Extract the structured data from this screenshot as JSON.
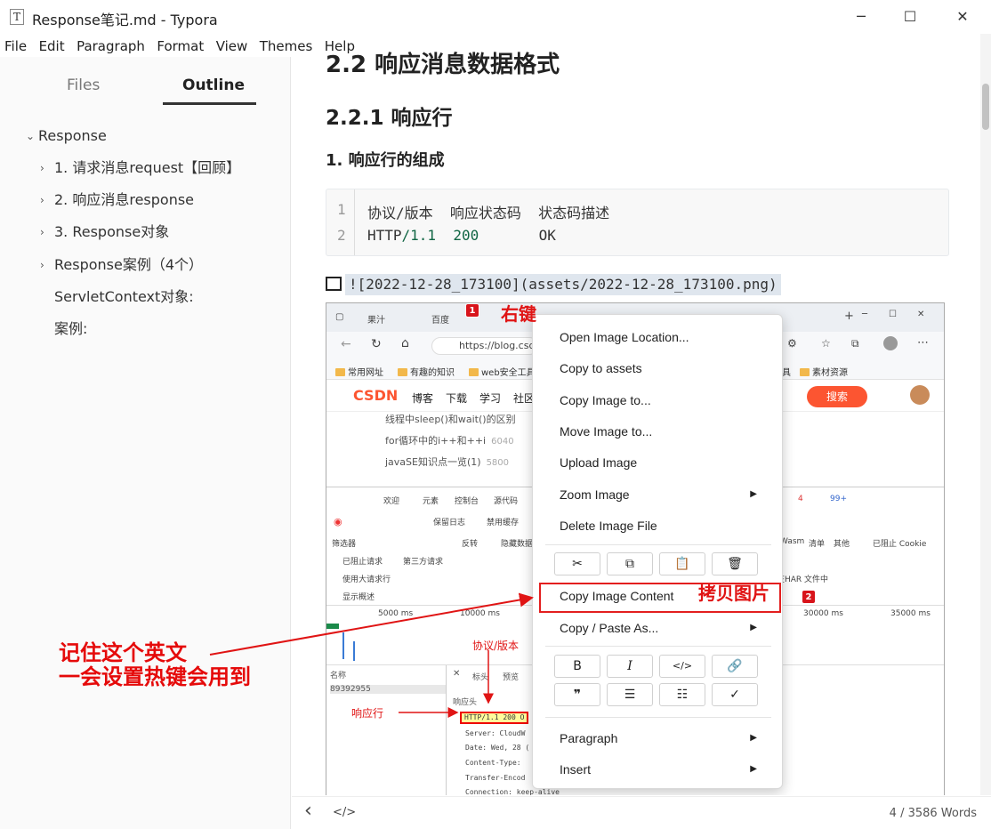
{
  "window": {
    "title": "Response笔记.md - Typora",
    "app_glyph": "T",
    "minimize": "─",
    "maximize": "☐",
    "close": "✕"
  },
  "menu": [
    "File",
    "Edit",
    "Paragraph",
    "Format",
    "View",
    "Themes",
    "Help"
  ],
  "sidebar": {
    "tabs": {
      "files": "Files",
      "outline": "Outline",
      "active": "Outline"
    },
    "outline": [
      {
        "label": "Response",
        "level": 0,
        "expanded": true
      },
      {
        "label": "1. 请求消息request【回顾】",
        "level": 1
      },
      {
        "label": "2. 响应消息response",
        "level": 1
      },
      {
        "label": "3. Response对象",
        "level": 1
      },
      {
        "label": "Response案例（4个）",
        "level": 1
      },
      {
        "label": "ServletContext对象:",
        "level": 1
      },
      {
        "label": "案例:",
        "level": 1
      }
    ]
  },
  "doc": {
    "h2": "2.2 响应消息数据格式",
    "h3": "2.2.1 响应行",
    "h4": "1. 响应行的组成",
    "code": {
      "line_numbers": [
        "1",
        "2"
      ],
      "line1": "协议/版本  响应状态码  状态码描述",
      "line2_a": "HTTP",
      "line2_b": "/1.1  200",
      "line2_c": "       OK"
    },
    "image_markdown": "![2022-12-28_173100](assets/2022-12-28_173100.png)"
  },
  "screenshot": {
    "tabs": [
      "果汁",
      "百度",
      "https://blog.csdn"
    ],
    "address": "https://blog.csdn",
    "bookmarks": [
      "常用网址",
      "有趣的知识",
      "web安全工具",
      "具",
      "素材资源"
    ],
    "csdn": {
      "logo": "CSDN",
      "nav": [
        "博客",
        "下载",
        "学习",
        "社区"
      ],
      "search": "搜索"
    },
    "articles": [
      {
        "title": "线程中sleep()和wait()的区别",
        "views": ""
      },
      {
        "title": "for循环中的i++和++i",
        "views": "6040"
      },
      {
        "title": "javaSE知识点一览(1)",
        "views": "5800"
      }
    ],
    "devtools": {
      "tabs": [
        "欢迎",
        "元素",
        "控制台",
        "源代码"
      ],
      "filter": "筛选器",
      "options": [
        "保留日志",
        "禁用缓存",
        "反转",
        "隐藏数据",
        "已阻止请求",
        "第三方请求",
        "使用大请求行",
        "显示概述"
      ],
      "right_opts": [
        "Wasm",
        "清单",
        "其他",
        "已阻止 Cookie",
        "在HAR 文件中"
      ],
      "counts": [
        "4",
        "99+"
      ],
      "timeline": [
        "5000 ms",
        "10000 ms",
        "30000 ms",
        "35000 ms"
      ],
      "name_header": "名称",
      "request_name": "89392955",
      "panel_tabs": [
        "标头",
        "预览"
      ],
      "section": "响应头",
      "status_line": "HTTP/1.1 200 O",
      "headers": [
        "Server: CloudW",
        "Date: Wed, 28 (",
        "Content-Type:",
        "Transfer-Encod",
        "Connection: keep-alive"
      ]
    },
    "context_menu": {
      "items_top": [
        "Open Image Location...",
        "Copy to assets",
        "Copy Image to...",
        "Move Image to...",
        "Upload Image",
        "Zoom Image",
        "Delete Image File"
      ],
      "toolbar1": [
        "cut-icon",
        "copy-icon",
        "paste-icon",
        "delete-icon"
      ],
      "highlight": "Copy Image Content",
      "copy_paste_as": "Copy / Paste As...",
      "format1": [
        "B",
        "I",
        "</>",
        "link-icon"
      ],
      "format2": [
        "quote-icon",
        "ordered-list-icon",
        "bullet-list-icon",
        "task-list-icon"
      ],
      "items_bottom": [
        "Paragraph",
        "Insert"
      ]
    },
    "annotations": {
      "right_click": "右键",
      "copy_image": "拷贝图片",
      "protocol_version": "协议/版本",
      "response_line": "响应行",
      "badge1": "1",
      "badge2": "2"
    }
  },
  "annotation_text": {
    "line1": "记住这个英文",
    "line2": "一会设置热键会用到"
  },
  "statusbar": {
    "back": "‹",
    "source": "</>",
    "word_count": "4 / 3586 Words"
  },
  "colors": {
    "accent_red": "#e01414",
    "csdn_orange": "#fc5531"
  }
}
